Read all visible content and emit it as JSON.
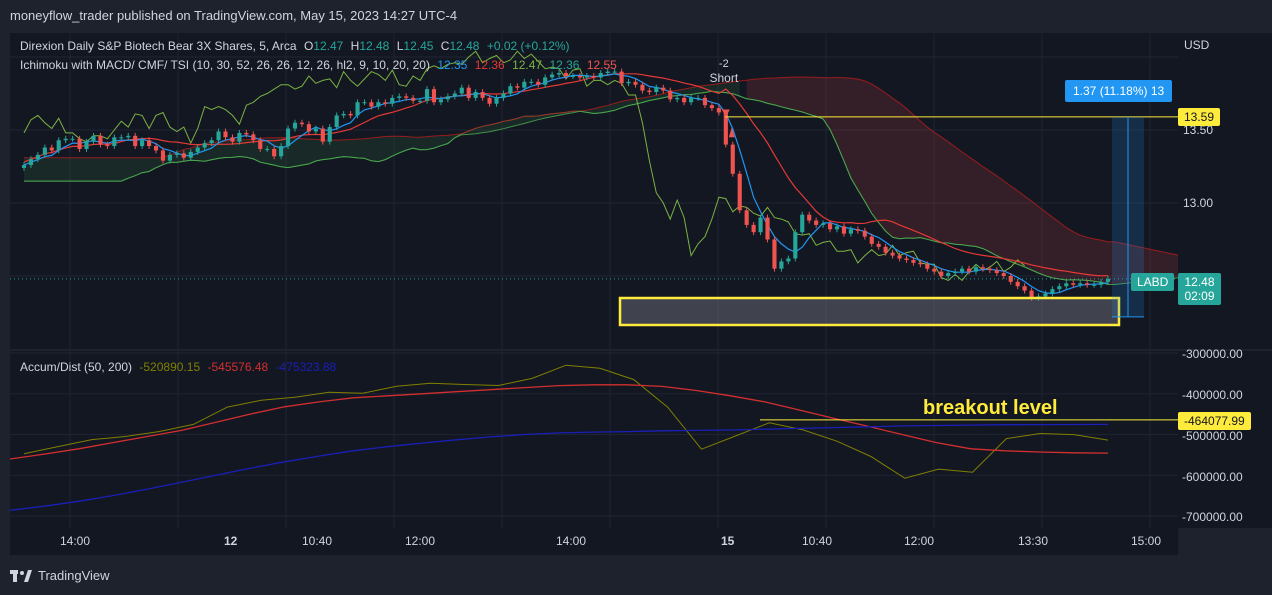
{
  "header": {
    "published": "moneyflow_trader published on TradingView.com, May 15, 2023 14:27 UTC-4"
  },
  "legend_main": {
    "symbol": "Direxion Daily S&P Biotech Bear 3X Shares, 5, Arca",
    "o_label": "O",
    "o": "12.47",
    "h_label": "H",
    "h": "12.48",
    "l_label": "L",
    "l": "12.45",
    "c_label": "C",
    "c": "12.48",
    "change": "+0.02 (+0.12%)",
    "indicator": "Ichimoku with MACD/ CMF/ TSI  (10, 30, 52, 26, 26, 12, 26, hl2, 9, 10, 20, 20)",
    "ind_values": [
      "12.35",
      "12.36",
      "12.47",
      "12.36",
      "12.55"
    ]
  },
  "legend_sub": {
    "indicator": "Accum/Dist (50, 200)",
    "values": [
      "-520890.15",
      "-545576.48",
      "-475323.88"
    ]
  },
  "annotations": {
    "short_count": "-2",
    "short_label": "Short",
    "breakout": "breakout level",
    "measure": "1.37 (11.18%) 13"
  },
  "price_axis": {
    "currency": "USD",
    "ticks": [
      "13.50",
      "13.00"
    ],
    "level_tag": "13.59",
    "symbol_tag": "LABD",
    "last_price": "12.48",
    "countdown": "02:09"
  },
  "sub_axis": {
    "ticks": [
      "-300000.00",
      "-400000.00",
      "-500000.00",
      "-600000.00",
      "-700000.00"
    ],
    "level_tag": "-464077.99"
  },
  "time_axis": {
    "ticks": [
      "14:00",
      "12",
      "10:40",
      "12:00",
      "14:00",
      "15",
      "10:40",
      "12:00",
      "13:30",
      "15:00"
    ]
  },
  "footer": {
    "brand": "TradingView"
  },
  "colors": {
    "bg": "#131722",
    "up": "#26a69a",
    "down": "#ef5350",
    "kijun": "#e53935",
    "tenkan": "#2196f3",
    "chikou": "#7cb342",
    "yellow": "#ffeb3b",
    "ad_olive": "#808000",
    "ad_red": "#d32f2f",
    "ad_blue": "#1a1fb8"
  },
  "chart_data": [
    {
      "type": "candlestick",
      "title": "Direxion Daily S&P Biotech Bear 3X Shares, 5, Arca",
      "ylabel": "USD",
      "ylim": [
        12.2,
        13.7
      ],
      "price_ticks": [
        13.5,
        13.0
      ],
      "x_ticks": [
        "14:00",
        "12",
        "10:40",
        "12:00",
        "14:00",
        "15",
        "10:40",
        "12:00",
        "13:30",
        "15:00"
      ],
      "close": [
        13.26,
        13.3,
        13.33,
        13.38,
        13.36,
        13.43,
        13.44,
        13.44,
        13.37,
        13.42,
        13.46,
        13.4,
        13.39,
        13.45,
        13.45,
        13.46,
        13.39,
        13.43,
        13.39,
        13.36,
        13.29,
        13.33,
        13.34,
        13.31,
        13.35,
        13.38,
        13.41,
        13.43,
        13.49,
        13.45,
        13.42,
        13.48,
        13.47,
        13.43,
        13.37,
        13.37,
        13.32,
        13.39,
        13.51,
        13.55,
        13.54,
        13.49,
        13.51,
        13.42,
        13.52,
        13.6,
        13.61,
        13.6,
        13.69,
        13.69,
        13.66,
        13.69,
        13.68,
        13.72,
        13.73,
        13.72,
        13.7,
        13.7,
        13.78,
        13.69,
        13.71,
        13.73,
        13.75,
        13.79,
        13.72,
        13.76,
        13.72,
        13.68,
        13.72,
        13.75,
        13.8,
        13.79,
        13.83,
        13.83,
        13.81,
        13.86,
        13.88,
        13.89,
        13.87,
        13.87,
        13.86,
        13.87,
        13.86,
        13.89,
        13.9,
        13.9,
        13.82,
        13.83,
        13.81,
        13.77,
        13.76,
        13.79,
        13.77,
        13.71,
        13.72,
        13.69,
        13.72,
        13.72,
        13.67,
        13.65,
        13.62,
        13.4,
        13.2,
        12.95,
        12.85,
        12.8,
        12.9,
        12.75,
        12.55,
        12.6,
        12.62,
        12.8,
        12.92,
        12.88,
        12.85,
        12.86,
        12.82,
        12.84,
        12.79,
        12.82,
        12.81,
        12.77,
        12.72,
        12.7,
        12.66,
        12.64,
        12.62,
        12.61,
        12.59,
        12.58,
        12.55,
        12.53,
        12.5,
        12.52,
        12.53,
        12.55,
        12.53,
        12.56,
        12.55,
        12.54,
        12.52,
        12.5,
        12.46,
        12.43,
        12.4,
        12.35,
        12.36,
        12.38,
        12.41,
        12.43,
        12.45,
        12.44,
        12.45,
        12.44,
        12.44,
        12.46,
        12.48
      ],
      "ichimoku": {
        "tenkan": "blue",
        "kijun": "red",
        "chikou": "green",
        "cloud": "dark green / red shading"
      },
      "annotations": [
        "-2 Short",
        "13.59 level",
        "1.37 (11.18%) measured move",
        "support box"
      ]
    },
    {
      "type": "line",
      "title": "Accum/Dist (50, 200)",
      "ylim": [
        -720000,
        -280000
      ],
      "y_ticks": [
        -300000,
        -400000,
        -500000,
        -600000,
        -700000
      ],
      "series": [
        {
          "name": "Accum/Dist",
          "color": "#808000",
          "values": [
            -540000,
            -525000,
            -510000,
            -505000,
            -495000,
            -480000,
            -440000,
            -410000,
            -405000,
            -395000,
            -400000,
            -385000,
            -380000,
            -370000,
            -375000,
            -360000,
            -330000,
            -340000,
            -370000,
            -440000,
            -530000,
            -500000,
            -470000,
            -490000,
            -520000,
            -560000,
            -600000,
            -580000,
            -590000,
            -510000,
            -500000,
            -505000,
            -520890
          ]
        },
        {
          "name": "MA 50",
          "color": "#d32f2f",
          "values": [
            -560000,
            -548000,
            -535000,
            -520000,
            -505000,
            -490000,
            -470000,
            -450000,
            -432000,
            -420000,
            -410000,
            -405000,
            -400000,
            -395000,
            -390000,
            -385000,
            -380000,
            -378000,
            -378000,
            -382000,
            -392000,
            -405000,
            -420000,
            -440000,
            -460000,
            -480000,
            -500000,
            -520000,
            -535000,
            -540000,
            -543000,
            -545000,
            -545576
          ]
        },
        {
          "name": "MA 200",
          "color": "#1a1fb8",
          "values": [
            -686000,
            -676000,
            -664000,
            -650000,
            -634000,
            -617000,
            -600000,
            -583000,
            -567000,
            -553000,
            -540000,
            -530000,
            -521000,
            -513000,
            -506000,
            -500000,
            -496000,
            -494000,
            -493000,
            -491000,
            -490000,
            -489000,
            -487000,
            -485000,
            -483000,
            -481000,
            -479000,
            -478000,
            -477000,
            -476000,
            -475800,
            -475500,
            -475323
          ]
        }
      ],
      "levels": [
        {
          "label": "breakout level",
          "value": -464077.99
        }
      ]
    }
  ]
}
